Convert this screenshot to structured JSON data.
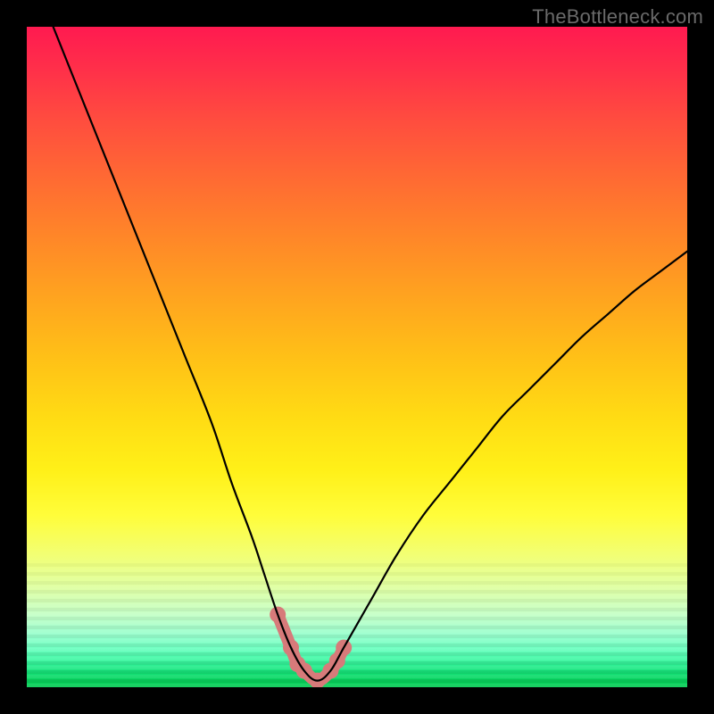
{
  "watermark": "TheBottleneck.com",
  "colors": {
    "frame": "#000000",
    "curve": "#000000",
    "marker": "#d77a7a",
    "gradient_top": "#ff1a50",
    "gradient_mid": "#ffe22a",
    "gradient_bottom": "#06cb54"
  },
  "chart_data": {
    "type": "line",
    "title": "",
    "xlabel": "",
    "ylabel": "",
    "xlim": [
      0,
      100
    ],
    "ylim": [
      0,
      100
    ],
    "grid": false,
    "legend": null,
    "series": [
      {
        "name": "bottleneck-curve",
        "x": [
          4,
          8,
          12,
          16,
          20,
          24,
          28,
          31,
          34,
          36,
          38,
          40,
          42,
          44,
          46,
          48,
          52,
          56,
          60,
          64,
          68,
          72,
          76,
          80,
          84,
          88,
          92,
          96,
          100
        ],
        "values": [
          100,
          90,
          80,
          70,
          60,
          50,
          40,
          31,
          23,
          17,
          11,
          6,
          2.5,
          1,
          2.5,
          6,
          13,
          20,
          26,
          31,
          36,
          41,
          45,
          49,
          53,
          56.5,
          60,
          63,
          66
        ]
      }
    ],
    "markers": {
      "name": "valley-highlight",
      "color": "#d77a7a",
      "points": [
        {
          "x": 38,
          "y": 11
        },
        {
          "x": 40,
          "y": 6
        },
        {
          "x": 41,
          "y": 3.5
        },
        {
          "x": 42,
          "y": 2.5
        },
        {
          "x": 44,
          "y": 1
        },
        {
          "x": 46,
          "y": 2.5
        },
        {
          "x": 47,
          "y": 4
        },
        {
          "x": 48,
          "y": 6
        }
      ]
    }
  }
}
